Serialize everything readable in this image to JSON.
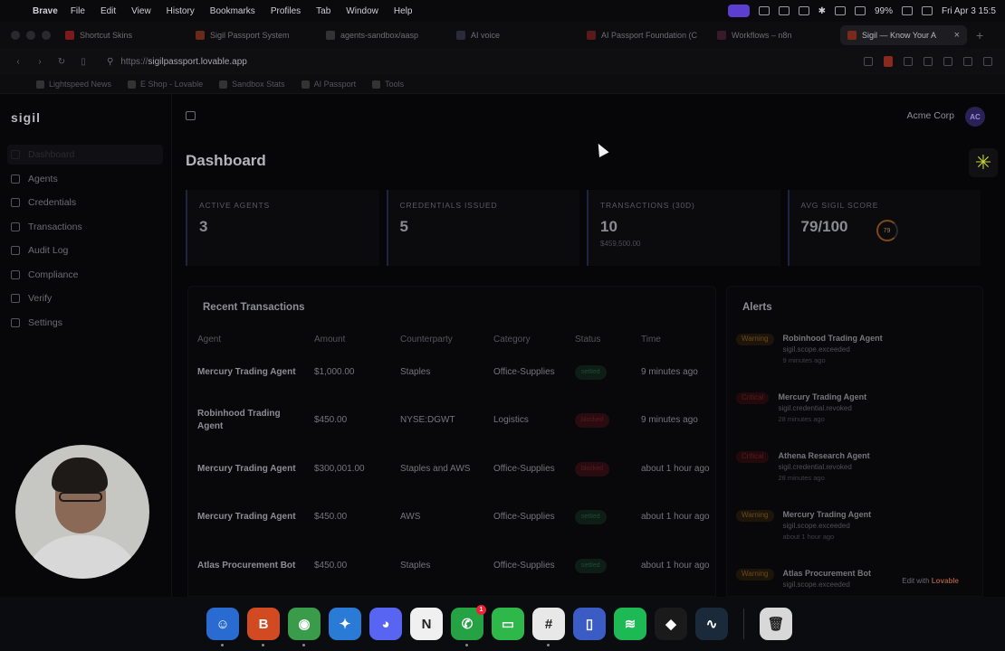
{
  "menubar": {
    "app_name": "Brave",
    "menus": [
      "File",
      "Edit",
      "View",
      "History",
      "Bookmarks",
      "Profiles",
      "Tab",
      "Window",
      "Help"
    ],
    "battery": "99%",
    "clock": "Fri Apr 3  15:5"
  },
  "tabs": [
    {
      "title": "Shortcut Skins",
      "color": "#7a1a1a",
      "active": false
    },
    {
      "title": "Sigil Passport System",
      "color": "#6a2a1a",
      "active": false
    },
    {
      "title": "agents-sandbox/aasp",
      "color": "#333333",
      "active": false
    },
    {
      "title": "AI voice",
      "color": "#2a2a3a",
      "active": false
    },
    {
      "title": "AI Passport Foundation (C",
      "color": "#5a1a1a",
      "active": false
    },
    {
      "title": "Workflows – n8n",
      "color": "#3a1a2a",
      "active": false
    },
    {
      "title": "Sigil — Know Your A",
      "color": "#7a2a1a",
      "active": true
    }
  ],
  "address": {
    "scheme": "https://",
    "host": "sigilpassport.lovable.app"
  },
  "bookmarks": [
    "Lightspeed News",
    "E Shop - Lovable",
    "Sandbox Stats",
    "AI Passport",
    "Tools"
  ],
  "app": {
    "logo": "sigil",
    "org_name": "Acme Corp",
    "avatar_initials": "AC",
    "nav": [
      {
        "label": "Dashboard",
        "icon": "grid-icon",
        "active": true
      },
      {
        "label": "Agents",
        "icon": "users-icon",
        "active": false
      },
      {
        "label": "Credentials",
        "icon": "shield-icon",
        "active": false
      },
      {
        "label": "Transactions",
        "icon": "swap-icon",
        "active": false
      },
      {
        "label": "Audit Log",
        "icon": "list-icon",
        "active": false
      },
      {
        "label": "Compliance",
        "icon": "file-icon",
        "active": false
      },
      {
        "label": "Verify",
        "icon": "check-circle-icon",
        "active": false
      },
      {
        "label": "Settings",
        "icon": "gear-icon",
        "active": false
      }
    ],
    "page_title": "Dashboard",
    "stats": [
      {
        "label": "Active Agents",
        "value": "3",
        "sub": ""
      },
      {
        "label": "Credentials Issued",
        "value": "5",
        "sub": ""
      },
      {
        "label": "Transactions (30D)",
        "value": "10",
        "sub": "$459,500.00"
      },
      {
        "label": "Avg Sigil Score",
        "value": "79/100",
        "sub": "",
        "ring": "79"
      }
    ],
    "transactions": {
      "title": "Recent Transactions",
      "columns": [
        "Agent",
        "Amount",
        "Counterparty",
        "Category",
        "Status",
        "Time"
      ],
      "rows": [
        {
          "agent": "Mercury Trading Agent",
          "amount": "$1,000.00",
          "counterparty": "Staples",
          "category": "Office-Supplies",
          "status": "settled",
          "status_type": "ok",
          "time": "9 minutes ago"
        },
        {
          "agent": "Robinhood Trading Agent",
          "amount": "$450.00",
          "counterparty": "NYSE:DGWT",
          "category": "Logistics",
          "status": "blocked",
          "status_type": "bad",
          "time": "9 minutes ago"
        },
        {
          "agent": "Mercury Trading Agent",
          "amount": "$300,001.00",
          "counterparty": "Staples and AWS",
          "category": "Office-Supplies",
          "status": "blocked",
          "status_type": "bad",
          "time": "about 1 hour ago"
        },
        {
          "agent": "Mercury Trading Agent",
          "amount": "$450.00",
          "counterparty": "AWS",
          "category": "Office-Supplies",
          "status": "settled",
          "status_type": "ok",
          "time": "about 1 hour ago"
        },
        {
          "agent": "Atlas Procurement Bot",
          "amount": "$450.00",
          "counterparty": "Staples",
          "category": "Office-Supplies",
          "status": "settled",
          "status_type": "ok",
          "time": "about 1 hour ago"
        }
      ]
    },
    "alerts": {
      "title": "Alerts",
      "items": [
        {
          "level": "Warning",
          "type": "warning",
          "agent": "Robinhood Trading Agent",
          "message": "sigil.scope.exceeded",
          "time": "9 minutes ago"
        },
        {
          "level": "Critical",
          "type": "critical",
          "agent": "Mercury Trading Agent",
          "message": "sigil.credential.revoked",
          "time": "28 minutes ago"
        },
        {
          "level": "Critical",
          "type": "critical",
          "agent": "Athena Research Agent",
          "message": "sigil.credential.revoked",
          "time": "28 minutes ago"
        },
        {
          "level": "Warning",
          "type": "warning",
          "agent": "Mercury Trading Agent",
          "message": "sigil.scope.exceeded",
          "time": "about 1 hour ago"
        },
        {
          "level": "Warning",
          "type": "warning",
          "agent": "Atlas Procurement Bot",
          "message": "sigil.scope.exceeded",
          "time": ""
        }
      ]
    },
    "edit_with": "Edit with",
    "edit_brand": "Lovable"
  },
  "dock": [
    {
      "name": "Finder",
      "icon": "finder-icon",
      "color": "#2a6bd1",
      "glyph": "☺"
    },
    {
      "name": "Brave",
      "icon": "brave-icon",
      "color": "#d14a22",
      "glyph": "B"
    },
    {
      "name": "Chrome",
      "icon": "chrome-icon",
      "color": "#3a9b4a",
      "glyph": "◉"
    },
    {
      "name": "Safari",
      "icon": "safari-icon",
      "color": "#2a7bd6",
      "glyph": "✦"
    },
    {
      "name": "Discord",
      "icon": "discord-icon",
      "color": "#5865f2",
      "glyph": "◕"
    },
    {
      "name": "Notion",
      "icon": "notion-icon",
      "color": "#f0f0f0",
      "glyph": "N"
    },
    {
      "name": "WhatsApp",
      "icon": "whatsapp-icon",
      "color": "#25a244",
      "glyph": "✆",
      "badge": "1"
    },
    {
      "name": "Messages",
      "icon": "messages-icon",
      "color": "#2fb84a",
      "glyph": "▭"
    },
    {
      "name": "Slack",
      "icon": "slack-icon",
      "color": "#e8e8e8",
      "glyph": "#"
    },
    {
      "name": "Preview",
      "icon": "preview-icon",
      "color": "#3b5cc4",
      "glyph": "▯"
    },
    {
      "name": "Spotify",
      "icon": "spotify-icon",
      "color": "#1db954",
      "glyph": "≋"
    },
    {
      "name": "Cursor",
      "icon": "cursor-app-icon",
      "color": "#1a1a1a",
      "glyph": "◆"
    },
    {
      "name": "n8n",
      "icon": "n8n-icon",
      "color": "#1a2a3a",
      "glyph": "∿"
    },
    {
      "name": "Trash",
      "icon": "trash-icon",
      "color": "#d8d8d8",
      "glyph": "🗑"
    }
  ]
}
